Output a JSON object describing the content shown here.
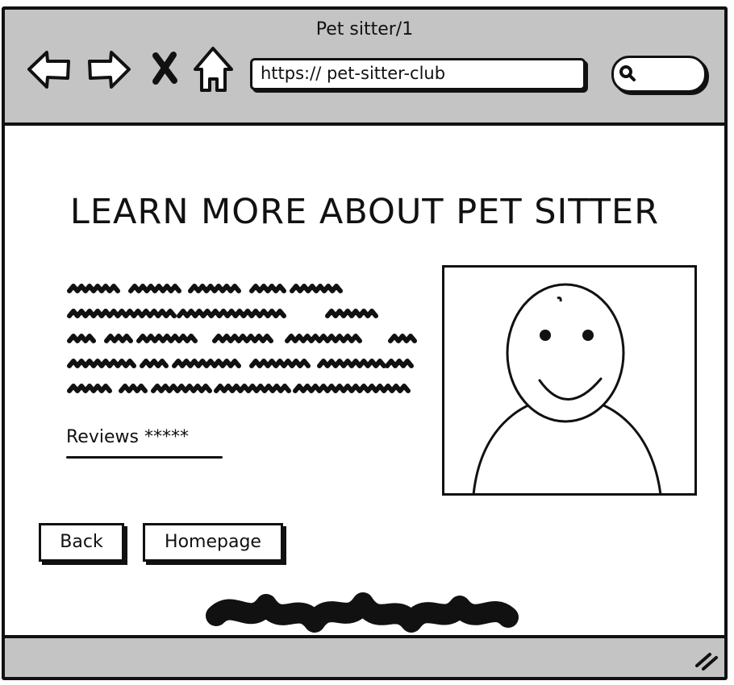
{
  "window": {
    "title": "Pet sitter/1"
  },
  "toolbar": {
    "back_icon": "arrow-left-icon",
    "forward_icon": "arrow-right-icon",
    "stop_icon": "close-icon",
    "home_icon": "home-icon",
    "url": "https://  pet-sitter-club",
    "search_icon": "search-icon"
  },
  "main": {
    "heading": "LEARN MORE ABOUT PET SITTER",
    "reviews_label": "Reviews *****",
    "profile_image_icon": "person-avatar-icon",
    "buttons": {
      "back": "Back",
      "homepage": "Homepage"
    }
  },
  "colors": {
    "chrome": "#c4c4c4",
    "ink": "#111111",
    "page": "#ffffff"
  }
}
